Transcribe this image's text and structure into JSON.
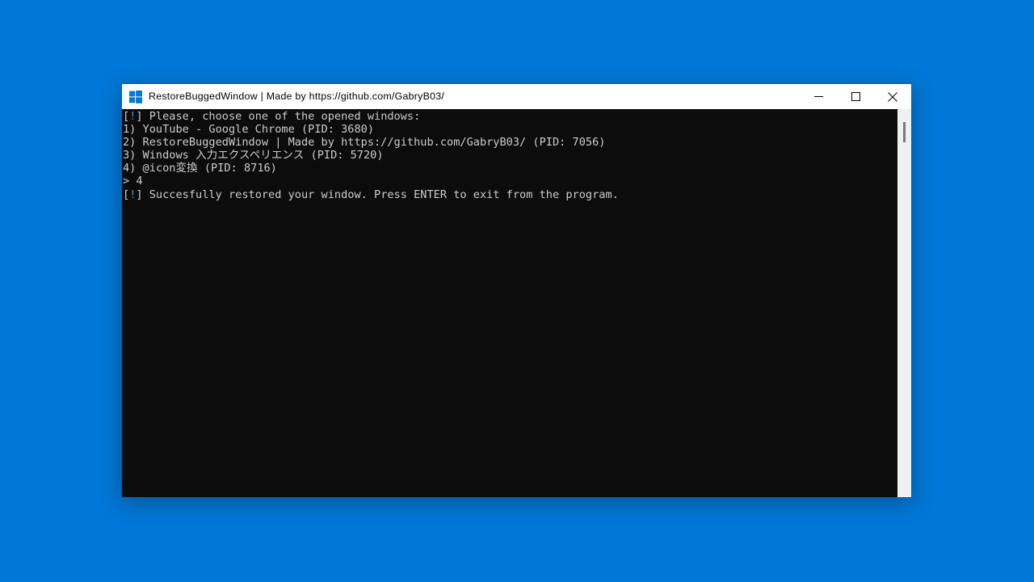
{
  "desktop": {
    "background_color": "#0078d7"
  },
  "window": {
    "title": "RestoreBuggedWindow | Made by https://github.com/GabryB03/",
    "icon": "windows-logo-icon",
    "background_color": "#0c0c0c",
    "border_color": "#0066b4",
    "titlebar_background": "#ffffff",
    "caption": {
      "minimize_label": "—",
      "maximize_label": "□",
      "close_label": "✕"
    },
    "scrollbar": {
      "track_color": "#f0f0f0",
      "thumb_color": "#7a7a7a"
    }
  },
  "console": {
    "foreground_color": "#cccccc",
    "accent_color": "#3a96dd",
    "lines": [
      {
        "id": "prompt-header",
        "segments": [
          {
            "text": "[",
            "color": "white"
          },
          {
            "text": "!",
            "color": "cyan"
          },
          {
            "text": "] Please, choose one of the opened windows:",
            "color": "white"
          }
        ]
      },
      {
        "id": "window-option-1",
        "segments": [
          {
            "text": "1) YouTube - Google Chrome (PID: 3680)",
            "color": "white"
          }
        ]
      },
      {
        "id": "window-option-2",
        "segments": [
          {
            "text": "2) RestoreBuggedWindow | Made by https://github.com/GabryB03/ (PID: 7056)",
            "color": "white"
          }
        ]
      },
      {
        "id": "window-option-3",
        "segments": [
          {
            "text": "3) Windows 入力エクスペリエンス (PID: 5720)",
            "color": "white"
          }
        ]
      },
      {
        "id": "window-option-4",
        "segments": [
          {
            "text": "4) @icon変換 (PID: 8716)",
            "color": "white"
          }
        ]
      },
      {
        "id": "user-input-line",
        "segments": [
          {
            "text": "> 4",
            "color": "white"
          }
        ]
      },
      {
        "id": "success-message",
        "segments": [
          {
            "text": "[",
            "color": "white"
          },
          {
            "text": "!",
            "color": "cyan"
          },
          {
            "text": "] Succesfully restored your window. Press ENTER to exit from the program.",
            "color": "white"
          }
        ]
      }
    ]
  }
}
